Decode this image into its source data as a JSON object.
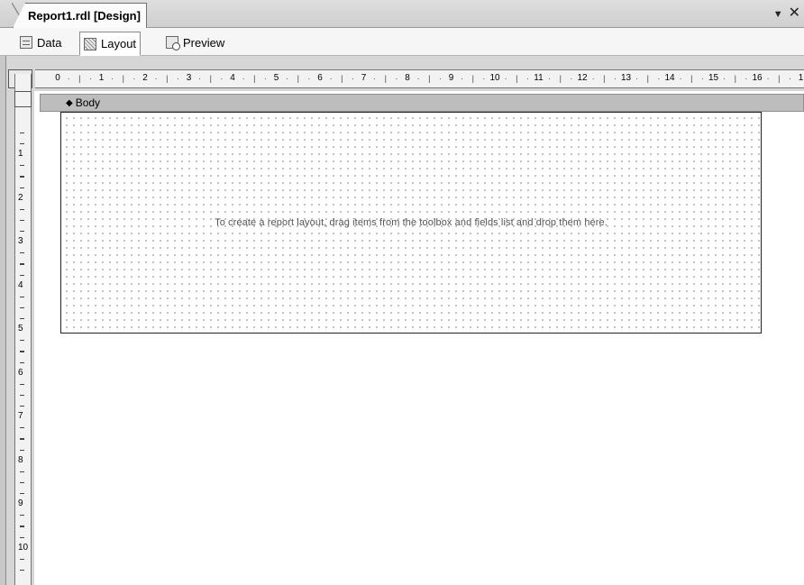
{
  "document": {
    "title": "Report1.rdl [Design]",
    "controls": {
      "pin_icon": "pin-dropdown-icon",
      "close_icon": "close-icon"
    }
  },
  "view_tabs": [
    {
      "label": "Data",
      "icon": "data-tab-icon",
      "active": false
    },
    {
      "label": "Layout",
      "icon": "layout-tab-icon",
      "active": true
    },
    {
      "label": "Preview",
      "icon": "preview-tab-icon",
      "active": false
    }
  ],
  "ruler": {
    "horizontal_marks": [
      "0",
      "1",
      "2",
      "3",
      "4",
      "5",
      "6",
      "7",
      "8",
      "9",
      "10",
      "11",
      "12",
      "13",
      "14",
      "15",
      "16",
      "1"
    ],
    "vertical_marks": [
      "1",
      "2",
      "3",
      "4",
      "5",
      "6",
      "7",
      "8",
      "9",
      "10"
    ]
  },
  "body_section": {
    "label": "Body",
    "hint": "To create a report layout, drag items from the toolbox and fields list and drop them here."
  },
  "colors": {
    "chrome": "#d6d6d6",
    "band": "#bdbdbd",
    "grid_dot": "#9a9a9a"
  }
}
